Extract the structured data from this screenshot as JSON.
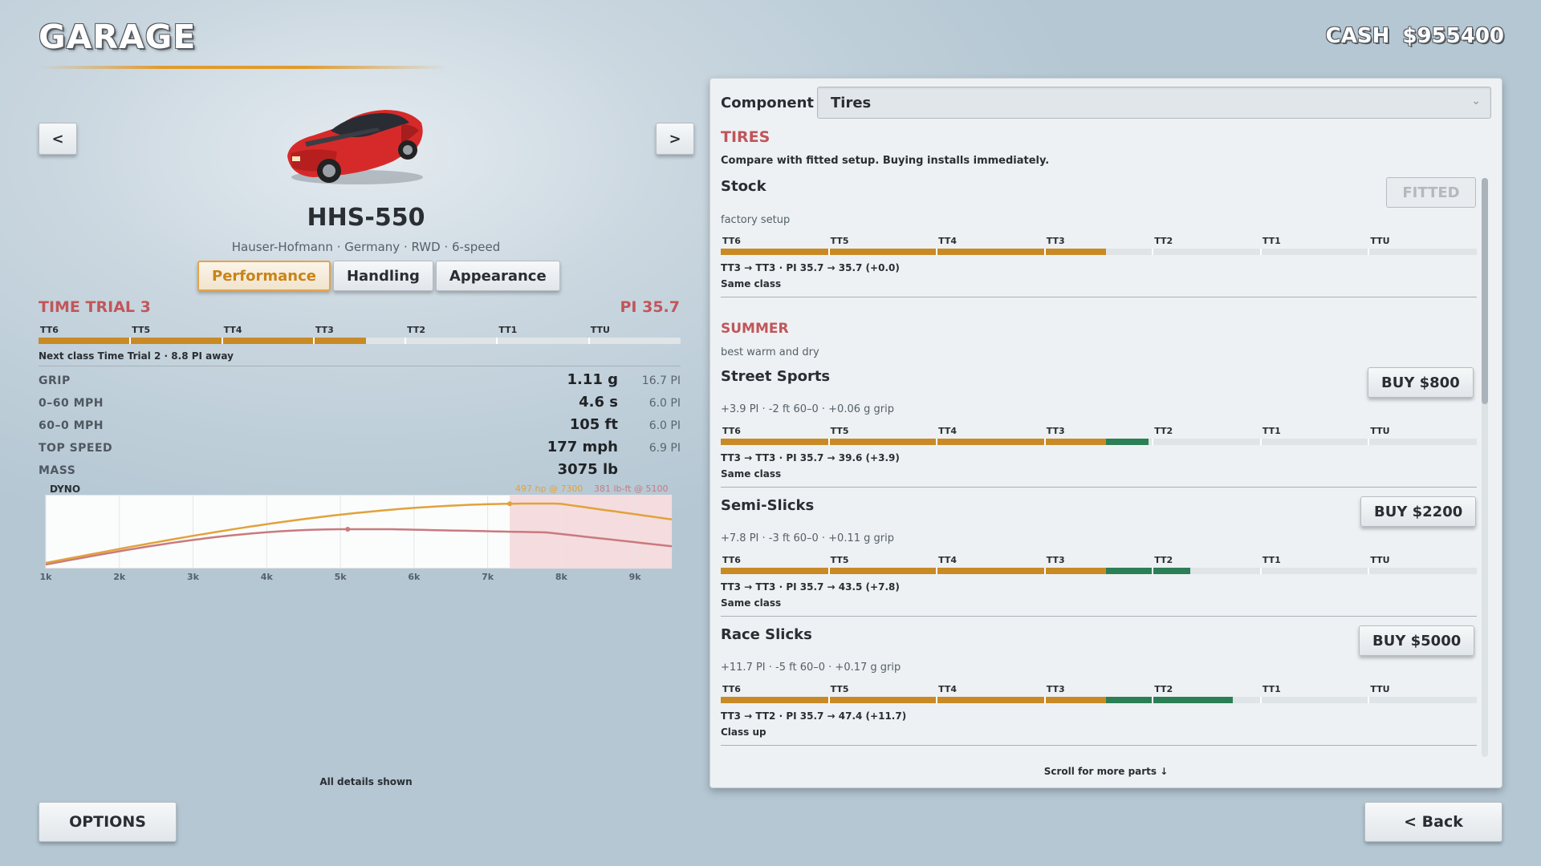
{
  "header": {
    "title": "GARAGE",
    "cash_label": "CASH",
    "cash_value": "$955400"
  },
  "nav": {
    "prev": "<",
    "next": ">"
  },
  "car": {
    "name": "HHS-550",
    "subtitle": "Hauser-Hofmann  ·  Germany  ·  RWD  ·  6-speed"
  },
  "tabs": [
    {
      "label": "Performance",
      "active": true
    },
    {
      "label": "Handling",
      "active": false
    },
    {
      "label": "Appearance",
      "active": false
    }
  ],
  "class_info": {
    "name": "TIME TRIAL 3",
    "pi": "PI 35.7",
    "pi_value": 35.7,
    "next_note": "Next class Time Trial 2  ·  8.8 PI away"
  },
  "class_tiers": [
    "TT6",
    "TT5",
    "TT4",
    "TT3",
    "TT2",
    "TT1",
    "TTU"
  ],
  "stats": [
    {
      "label": "GRIP",
      "value": "1.11 g",
      "pi": "16.7 PI"
    },
    {
      "label": "0–60 MPH",
      "value": "4.6 s",
      "pi": "6.0 PI"
    },
    {
      "label": "60–0 MPH",
      "value": "105 ft",
      "pi": "6.0 PI"
    },
    {
      "label": "TOP SPEED",
      "value": "177 mph",
      "pi": "6.9 PI"
    },
    {
      "label": "MASS",
      "value": "3075 lb",
      "pi": ""
    }
  ],
  "dyno": {
    "label": "DYNO",
    "hp_note": "497 hp @ 7300",
    "tq_note": "381 lb-ft @ 5100",
    "ticks": [
      "1k",
      "2k",
      "3k",
      "4k",
      "5k",
      "6k",
      "7k",
      "8k",
      "9k"
    ],
    "redline_rpm": 7300,
    "colors": {
      "hp": "#e2a23a",
      "tq": "#c97a7e"
    }
  },
  "details_note": "All details shown",
  "buttons": {
    "options": "OPTIONS",
    "back": "< Back"
  },
  "panel": {
    "component_label": "Component",
    "component_value": "Tires",
    "section": "TIRES",
    "intro": "Compare with fitted setup. Buying installs immediately.",
    "scroll_note": "Scroll for more parts ↓",
    "stock": {
      "name": "Stock",
      "button": "FITTED",
      "desc": "factory setup",
      "result": "TT3 → TT3 · PI 35.7 → 35.7 (+0.0)",
      "note": "Same class",
      "new_pi": 35.7
    },
    "subsection": "SUMMER",
    "subsection_desc": "best warm and dry",
    "parts": [
      {
        "name": "Street Sports",
        "button": "BUY  $800",
        "desc": "+3.9 PI · -2 ft 60–0 · +0.06 g grip",
        "result": "TT3 → TT3 · PI 35.7 → 39.6 (+3.9)",
        "note": "Same class",
        "new_pi": 39.6
      },
      {
        "name": "Semi-Slicks",
        "button": "BUY  $2200",
        "desc": "+7.8 PI · -3 ft 60–0 · +0.11 g grip",
        "result": "TT3 → TT3 · PI 35.7 → 43.5 (+7.8)",
        "note": "Same class",
        "new_pi": 43.5
      },
      {
        "name": "Race Slicks",
        "button": "BUY  $5000",
        "desc": "+11.7 PI · -5 ft 60–0 · +0.17 g grip",
        "result": "TT3 → TT2 · PI 35.7 → 47.4 (+11.7)",
        "note": "Class up",
        "new_pi": 47.4
      }
    ]
  }
}
